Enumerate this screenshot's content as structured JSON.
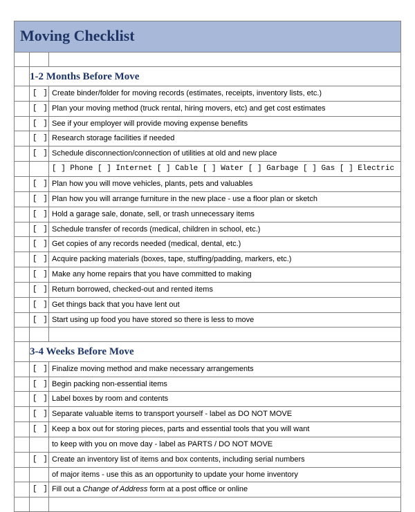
{
  "title": "Moving Checklist",
  "checkbox": "[  ]",
  "sections": [
    {
      "heading": "1-2 Months Before Move",
      "items": [
        {
          "type": "task",
          "text": "Create binder/folder for moving records (estimates, receipts, inventory lists, etc.)"
        },
        {
          "type": "task",
          "text": "Plan your moving method (truck rental, hiring movers, etc) and get cost estimates"
        },
        {
          "type": "task",
          "text": "See if your employer will provide moving expense benefits"
        },
        {
          "type": "task",
          "text": "Research storage facilities if needed"
        },
        {
          "type": "task",
          "text": "Schedule disconnection/connection of utilities at old and new place"
        },
        {
          "type": "sublist",
          "text": "[  ] Phone   [  ] Internet   [  ] Cable   [  ] Water   [  ] Garbage   [  ] Gas    [  ] Electric"
        },
        {
          "type": "task",
          "text": "Plan how you will move vehicles, plants, pets and valuables"
        },
        {
          "type": "task",
          "text": "Plan how you will arrange furniture in the new place - use a floor plan or sketch"
        },
        {
          "type": "task",
          "text": "Hold a garage sale, donate, sell, or trash unnecessary items"
        },
        {
          "type": "task",
          "text": "Schedule transfer of records (medical, children in school, etc.)"
        },
        {
          "type": "task",
          "text": "Get copies of any records needed (medical, dental, etc.)"
        },
        {
          "type": "task",
          "text": "Acquire packing materials (boxes, tape, stuffing/padding, markers, etc.)"
        },
        {
          "type": "task",
          "text": "Make any home repairs that you have committed to making"
        },
        {
          "type": "task",
          "text": "Return borrowed, checked-out and rented items"
        },
        {
          "type": "task",
          "text": "Get things back that you have lent out"
        },
        {
          "type": "task",
          "text": "Start using up food you have stored so there is less to move"
        }
      ]
    },
    {
      "heading": "3-4 Weeks Before Move",
      "items": [
        {
          "type": "task",
          "text": "Finalize moving method and make necessary arrangements"
        },
        {
          "type": "task",
          "text": "Begin packing non-essential items"
        },
        {
          "type": "task",
          "text": "Label boxes by room and contents"
        },
        {
          "type": "task",
          "text": "Separate valuable items to transport yourself - label as DO NOT MOVE"
        },
        {
          "type": "task",
          "text": "Keep a box out for storing pieces, parts and essential tools that you will want"
        },
        {
          "type": "cont",
          "text": "to keep with you on move day - label as PARTS / DO NOT MOVE"
        },
        {
          "type": "task",
          "text": "Create an inventory list of items and box contents, including serial numbers"
        },
        {
          "type": "cont",
          "text": "of major items - use this as an opportunity to update your home inventory"
        },
        {
          "type": "task",
          "html": "Fill out a <span class=\"italic\">Change of Address</span> form at a post office or online"
        }
      ]
    }
  ]
}
